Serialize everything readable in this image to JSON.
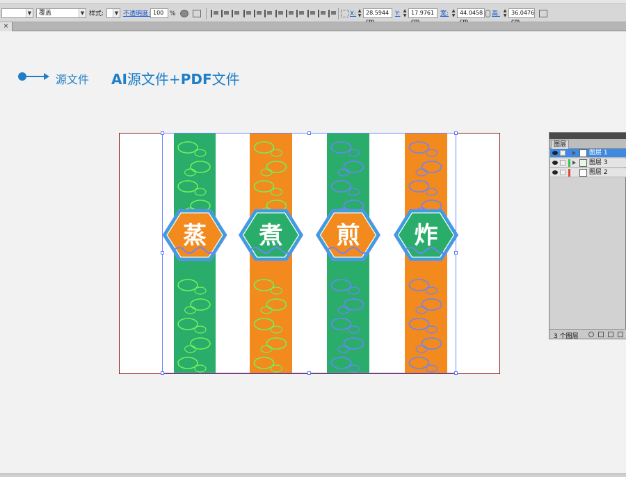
{
  "toolbar": {
    "blend_mode": "覆盖",
    "style_label": "样式:",
    "opacity_label": "不透明度:",
    "opacity_value": "100",
    "percent": "%",
    "x_label": "X:",
    "x_value": "28.5944 cm",
    "y_label": "Y:",
    "y_value": "17.9761 cm",
    "w_label": "宽:",
    "w_value": "44.0458 cm",
    "h_label": "高:",
    "h_value": "36.0476 cm"
  },
  "annotation": {
    "source_label": "源文件",
    "description_ai": "AI",
    "description_mid": "源文件+",
    "description_pdf": "PDF",
    "description_end": "文件"
  },
  "artboard": {
    "stripes": [
      {
        "color": "#2aad6a",
        "motif": "#73f05a",
        "char": "蒸",
        "badge_fill": "#f28a1e",
        "badge_ring": "#3aa0d8"
      },
      {
        "color": "#f28a1e",
        "motif": "#73f05a",
        "char": "煮",
        "badge_fill": "#2aad6a",
        "badge_ring": "#3aa0d8"
      },
      {
        "color": "#2aad6a",
        "motif": "#6b84ff",
        "char": "煎",
        "badge_fill": "#f28a1e",
        "badge_ring": "#3aa0d8"
      },
      {
        "color": "#f28a1e",
        "motif": "#6b84ff",
        "char": "炸",
        "badge_fill": "#2aad6a",
        "badge_ring": "#3aa0d8"
      }
    ]
  },
  "layers_panel": {
    "title": "图层",
    "layers": [
      {
        "name": "图层 1",
        "color": "#4a7dff",
        "selected": true
      },
      {
        "name": "图层 3",
        "color": "#38c24f",
        "selected": false
      },
      {
        "name": "图层 2",
        "color": "#e84343",
        "selected": false
      }
    ],
    "footer_count": "3 个图层"
  }
}
